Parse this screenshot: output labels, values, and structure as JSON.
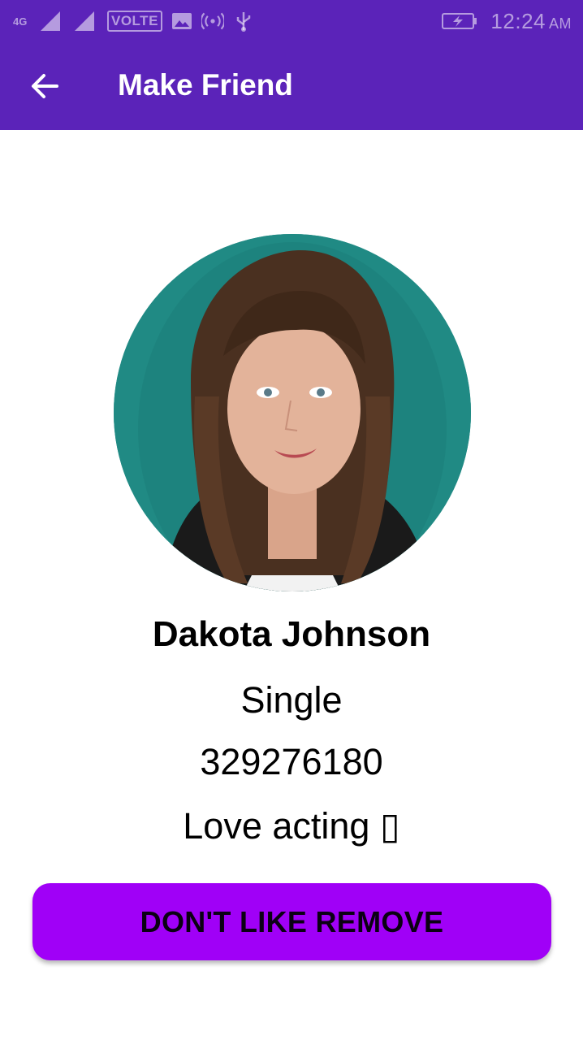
{
  "status_bar": {
    "network_1": "4G",
    "volte": "VOLTE",
    "time": "12:24",
    "ampm": "AM",
    "icons": [
      "signal-1-icon",
      "signal-2-icon",
      "gallery-icon",
      "hotspot-icon",
      "usb-icon",
      "battery-charging-icon"
    ]
  },
  "app_bar": {
    "title": "Make Friend",
    "back_icon": "arrow-back-icon",
    "color": "#5b23b9"
  },
  "profile": {
    "name": "Dakota Johnson",
    "relationship_status": "Single",
    "phone": "329276180",
    "bio": "Love acting ▯"
  },
  "actions": {
    "remove_label": "DON'T LIKE REMOVE",
    "remove_color": "#a000f7"
  }
}
